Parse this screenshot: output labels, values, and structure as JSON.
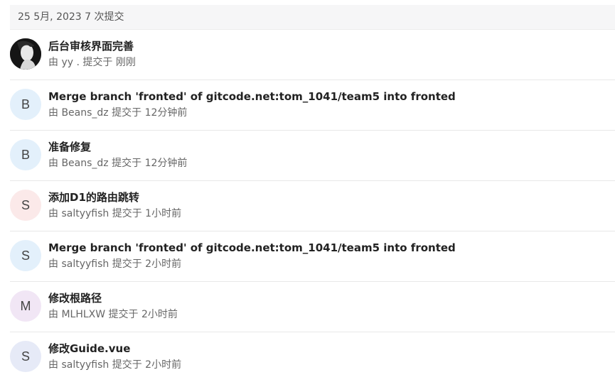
{
  "date_header": "25 5月, 2023 7 次提交",
  "commits": [
    {
      "title": "后台审核界面完善",
      "prefix": "由",
      "author": "yy .",
      "suffix": "提交于",
      "time": "刚刚",
      "avatar_type": "photo",
      "avatar_letter": "",
      "avatar_bg": "#111111"
    },
    {
      "title": "Merge branch 'fronted' of gitcode.net:tom_1041/team5 into fronted",
      "prefix": "由",
      "author": "Beans_dz",
      "suffix": "提交于",
      "time": "12分钟前",
      "avatar_type": "letter",
      "avatar_letter": "B",
      "avatar_bg": "#e3f0fb"
    },
    {
      "title": "准备修复",
      "prefix": "由",
      "author": "Beans_dz",
      "suffix": "提交于",
      "time": "12分钟前",
      "avatar_type": "letter",
      "avatar_letter": "B",
      "avatar_bg": "#e3f0fb"
    },
    {
      "title": "添加D1的路由跳转",
      "prefix": "由",
      "author": "saltyyfish",
      "suffix": "提交于",
      "time": "1小时前",
      "avatar_type": "letter",
      "avatar_letter": "S",
      "avatar_bg": "#fbe9e9"
    },
    {
      "title": "Merge branch 'fronted' of gitcode.net:tom_1041/team5 into fronted",
      "prefix": "由",
      "author": "saltyyfish",
      "suffix": "提交于",
      "time": "2小时前",
      "avatar_type": "letter",
      "avatar_letter": "S",
      "avatar_bg": "#e3f0fb"
    },
    {
      "title": "修改根路径",
      "prefix": "由",
      "author": "MLHLXW",
      "suffix": "提交于",
      "time": "2小时前",
      "avatar_type": "letter",
      "avatar_letter": "M",
      "avatar_bg": "#f1e6f5"
    },
    {
      "title": "修改Guide.vue",
      "prefix": "由",
      "author": "saltyyfish",
      "suffix": "提交于",
      "time": "2小时前",
      "avatar_type": "letter",
      "avatar_letter": "S",
      "avatar_bg": "#e6eaf7"
    }
  ]
}
